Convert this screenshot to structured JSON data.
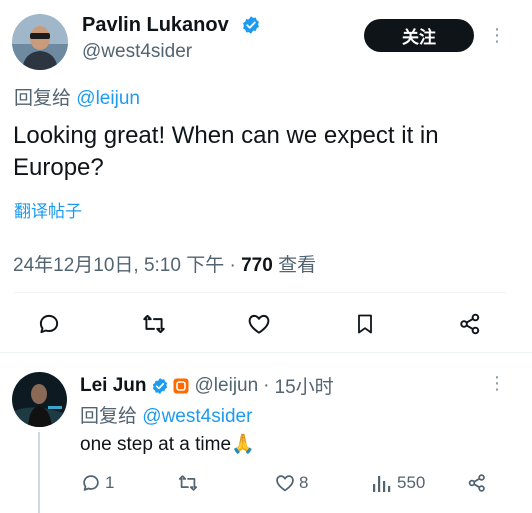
{
  "tweet": {
    "author_name": "Pavlin Lukanov",
    "author_handle": "@west4sider",
    "follow_label": "关注",
    "reply_prefix": "回复给",
    "reply_to": "@leijun",
    "text_line1": "Looking great! When can we expect it in",
    "text_line2": "Europe?",
    "translate_label": "翻译帖子",
    "timestamp": "24年12月10日, 5:10 下午",
    "separator": "·",
    "views_count": "770",
    "views_label": "查看"
  },
  "reply": {
    "author_name": "Lei Jun",
    "author_handle": "@leijun",
    "separator": "·",
    "time": "15小时",
    "reply_prefix": "回复给",
    "reply_to": "@west4sider",
    "text": "one step at a time",
    "emoji": "🙏",
    "reply_count": "1",
    "like_count": "8",
    "view_count": "550"
  },
  "colors": {
    "accent": "#1d9bf0",
    "text": "#0f1419",
    "muted": "#536471",
    "follow_bg": "#0f1419",
    "brand_badge": "#ff6900"
  }
}
